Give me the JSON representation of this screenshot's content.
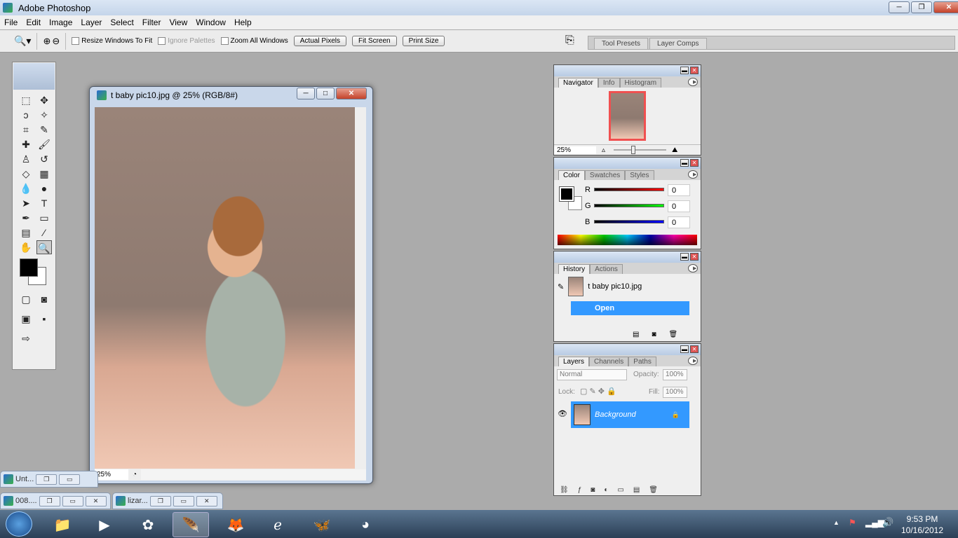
{
  "app": {
    "title": "Adobe Photoshop"
  },
  "menu": [
    "File",
    "Edit",
    "Image",
    "Layer",
    "Select",
    "Filter",
    "View",
    "Window",
    "Help"
  ],
  "options": {
    "resize_windows": "Resize Windows To Fit",
    "ignore_palettes": "Ignore Palettes",
    "zoom_all": "Zoom All Windows",
    "actual_pixels": "Actual Pixels",
    "fit_screen": "Fit Screen",
    "print_size": "Print Size"
  },
  "palette_well": [
    "Tool Presets",
    "Layer Comps"
  ],
  "document": {
    "title": "t baby pic10.jpg @ 25% (RGB/8#)",
    "zoom": "25%"
  },
  "navigator": {
    "tabs": [
      "Navigator",
      "Info",
      "Histogram"
    ],
    "zoom": "25%"
  },
  "color": {
    "tabs": [
      "Color",
      "Swatches",
      "Styles"
    ],
    "r_label": "R",
    "g_label": "G",
    "b_label": "B",
    "r": "0",
    "g": "0",
    "b": "0",
    "foreground": "#000000",
    "background": "#ffffff"
  },
  "history": {
    "tabs": [
      "History",
      "Actions"
    ],
    "snapshot": "t baby pic10.jpg",
    "step": "Open"
  },
  "layers": {
    "tabs": [
      "Layers",
      "Channels",
      "Paths"
    ],
    "blend": "Normal",
    "opacity_label": "Opacity:",
    "opacity": "100%",
    "lock_label": "Lock:",
    "fill_label": "Fill:",
    "fill": "100%",
    "layer": "Background"
  },
  "minimized": [
    "Unt...",
    "008....",
    "lizar..."
  ],
  "tray": {
    "time": "9:53 PM",
    "date": "10/16/2012"
  },
  "colors": {
    "accent": "#3399ff"
  }
}
